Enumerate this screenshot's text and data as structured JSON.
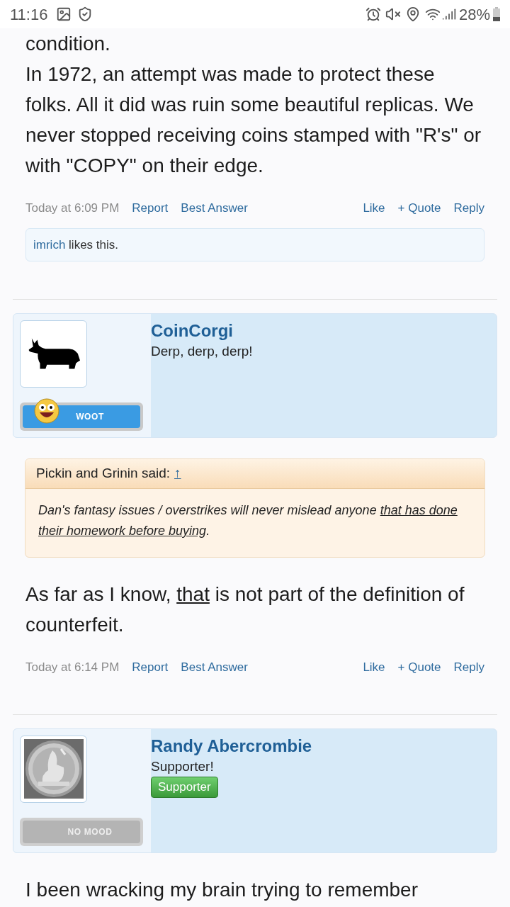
{
  "status_bar": {
    "time": "11:16",
    "battery": "28%"
  },
  "posts": [
    {
      "body": [
        [
          {
            "text": "condition.",
            "underline": false
          }
        ],
        [
          {
            "text": "In 1972, an attempt was made to protect these folks. All it did was ruin some beautiful replicas. We never stopped receiving coins stamped with \"R's\" or with \"COPY\" on their edge.",
            "underline": false
          }
        ]
      ],
      "meta": {
        "time": "Today at 6:09 PM",
        "left": [
          "Report",
          "Best Answer"
        ],
        "right": [
          "Like",
          "+ Quote",
          "Reply"
        ]
      },
      "likes": {
        "user": "imrich",
        "text": "likes this."
      }
    },
    {
      "user": {
        "name": "CoinCorgi",
        "title": "Derp, derp, derp!",
        "avatar": {
          "kind": "silhouette"
        },
        "mood": {
          "kind": "woot",
          "label": "WOOT"
        }
      },
      "quote": {
        "author": "Pickin and Grinin said:",
        "link": "↑",
        "segments": [
          {
            "text": "Dan's fantasy issues / overstrikes will never mislead anyone ",
            "underline": false
          },
          {
            "text": "that has done their homework before buying",
            "underline": true
          },
          {
            "text": ".",
            "underline": false
          }
        ]
      },
      "body": [
        [
          {
            "text": "As far as I know, ",
            "underline": false
          },
          {
            "text": "that",
            "underline": true
          },
          {
            "text": " is not part of the definition of counterfeit.",
            "underline": false
          }
        ]
      ],
      "meta": {
        "time": "Today at 6:14 PM",
        "left": [
          "Report",
          "Best Answer"
        ],
        "right": [
          "Like",
          "+ Quote",
          "Reply"
        ]
      }
    },
    {
      "user": {
        "name": "Randy Abercrombie",
        "title": "Supporter!",
        "banner": "Supporter",
        "mood": {
          "kind": "none",
          "label": "NO MOOD"
        }
      },
      "body": [
        [
          {
            "text": "I been wracking my brain trying to remember",
            "underline": false
          }
        ]
      ]
    }
  ]
}
